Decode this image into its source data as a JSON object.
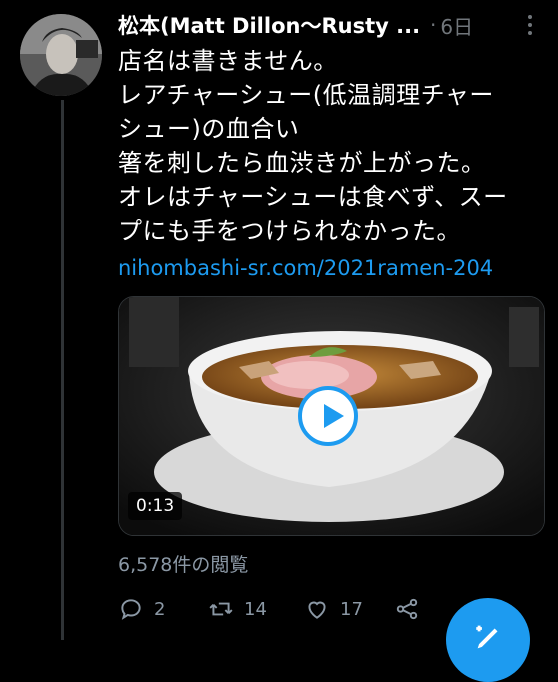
{
  "tweet": {
    "author": "松本(Matt Dillon〜Rusty ...",
    "dot": "·",
    "time": "6日",
    "lines": [
      "店名は書きません。",
      "レアチャーシュー(低温調理チャー",
      "シュー)の血合い",
      "箸を刺したら血渋きが上がった。",
      "オレはチャーシューは食べず、スー",
      "プにも手をつけられなかった。"
    ],
    "link": "nihombashi-sr.com/2021ramen-204"
  },
  "media": {
    "duration": "0:13"
  },
  "views": "6,578件の閲覧",
  "actions": {
    "reply_count": "2",
    "retweet_count": "14",
    "like_count": "17"
  },
  "colors": {
    "background": "#000000",
    "accent": "#1d9bf0",
    "muted": "#8b98a5"
  }
}
